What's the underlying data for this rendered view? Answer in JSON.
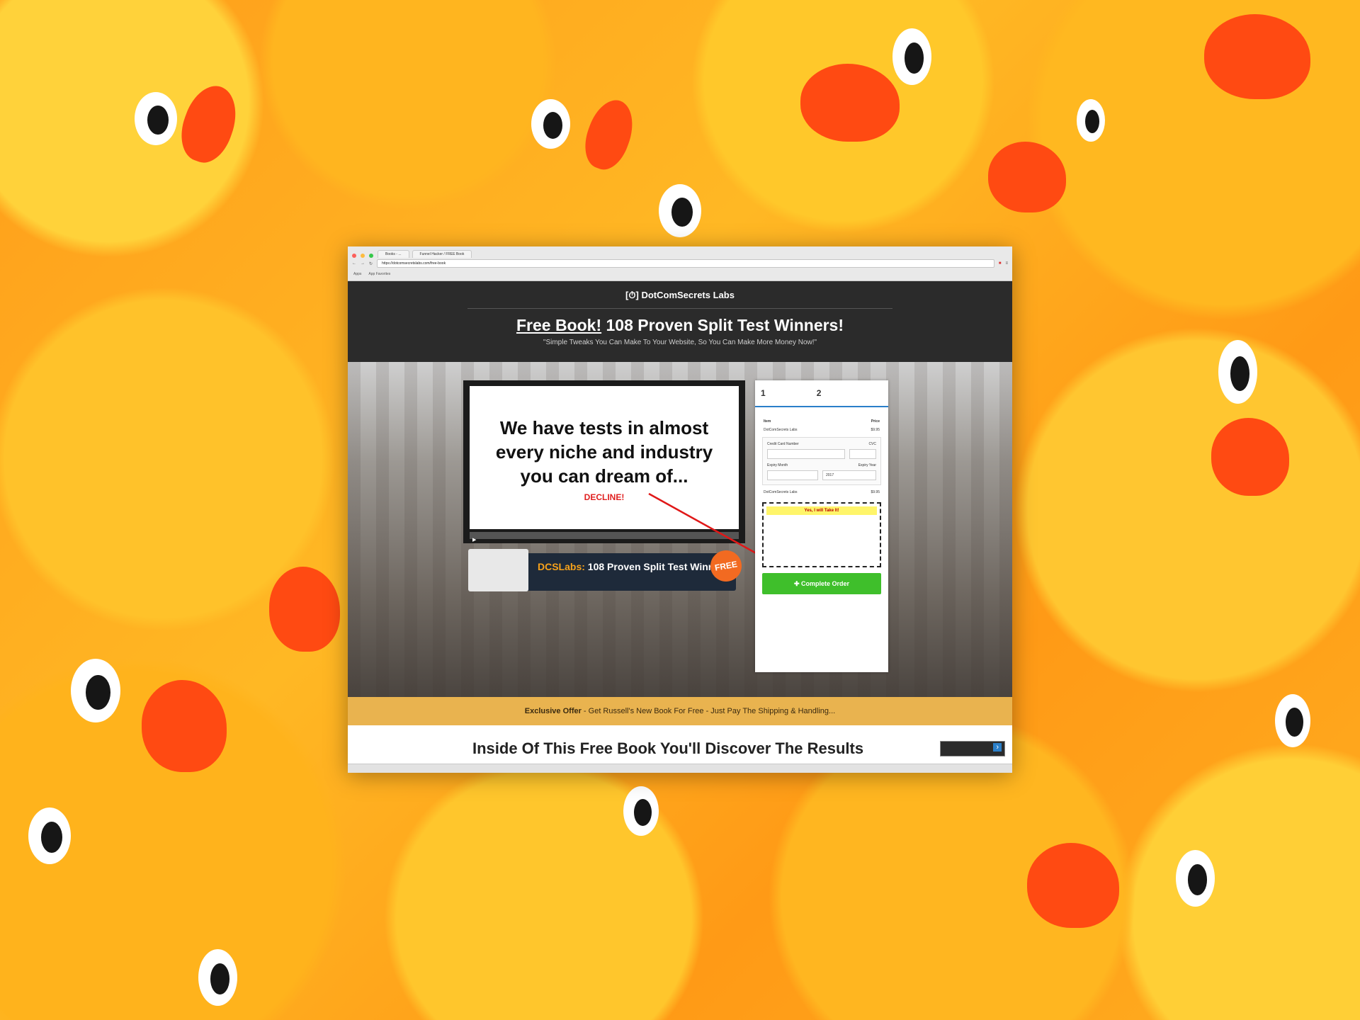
{
  "browser": {
    "tabs": [
      "Books - ...",
      "Funnel Hacker / FREE Book"
    ],
    "address": "https://dotcomsecretslabs.com/free-book",
    "bookmarks": [
      "Apps",
      "App Favorites"
    ]
  },
  "header": {
    "logo": "[⏱] DotComSecrets Labs",
    "headline_link": "Free Book!",
    "headline_rest": " 108 Proven Split Test Winners!",
    "subhead": "\"Simple Tweaks You Can Make To Your Website, So You Can Make More Money Now!\""
  },
  "video": {
    "text": "We have tests in almost every niche and industry you can dream of...",
    "decline": "DECLINE!"
  },
  "promo": {
    "brand": "DCSLabs:",
    "title": " 108 Proven Split Test Winners!",
    "badge": "FREE"
  },
  "form": {
    "step1": "1",
    "step2": "2",
    "col_item": "Item",
    "col_price": "Price",
    "product": "DotComSecrets Labs",
    "price": "$9.95",
    "cc_label": "Credit Card Number",
    "cvc_label": "CVC",
    "exp_month": "Expiry Month",
    "exp_year": "Expiry Year",
    "year_value": "2017",
    "offer_headline": "Yes, I will Take It!",
    "complete": "Complete Order"
  },
  "strip": {
    "bold": "Exclusive Offer",
    "text": " - Get Russell's New Book For Free - Just Pay The Shipping & Handling..."
  },
  "section": {
    "title": "Inside Of This Free Book You'll Discover The Results"
  }
}
